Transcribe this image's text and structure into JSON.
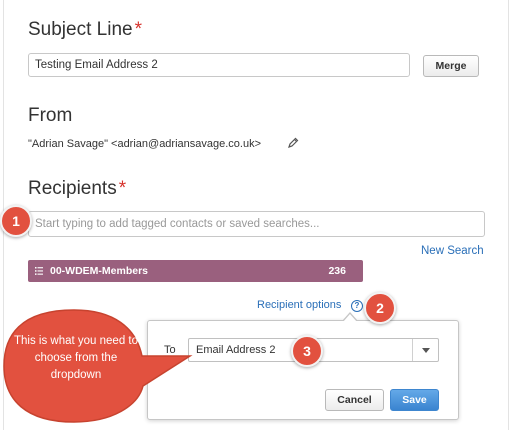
{
  "subject": {
    "title": "Subject Line",
    "required_mark": "*",
    "value": "Testing Email Address 2",
    "merge_label": "Merge"
  },
  "from": {
    "title": "From",
    "value": "\"Adrian Savage\" <adrian@adriansavage.co.uk>",
    "edit_icon": "pencil-icon"
  },
  "recipients": {
    "title": "Recipients",
    "required_mark": "*",
    "placeholder": "Start typing to add tagged contacts or saved searches...",
    "new_search_label": "New Search",
    "tag": {
      "name": "00-WDEM-Members",
      "count": "236",
      "icon": "list-icon"
    },
    "options_label": "Recipient options",
    "help_icon": "question-circle-icon"
  },
  "popover": {
    "to_label": "To",
    "selected": "Email Address 2",
    "cancel_label": "Cancel",
    "save_label": "Save"
  },
  "annotations": {
    "badges": [
      "1",
      "2",
      "3"
    ],
    "callout_text": "This is what you need to choose from the dropdown"
  },
  "colors": {
    "tag_bg": "#9a607e",
    "link": "#2a6fb8",
    "required": "#d6322c",
    "badge": "#e2513f",
    "save_button": "#3a84d0"
  }
}
